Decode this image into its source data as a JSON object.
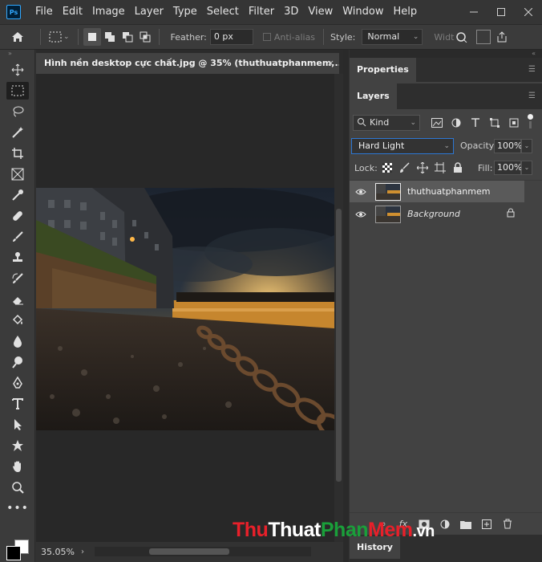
{
  "app": {
    "logo": "Ps"
  },
  "menu": [
    "File",
    "Edit",
    "Image",
    "Layer",
    "Type",
    "Select",
    "Filter",
    "3D",
    "View",
    "Window",
    "Help"
  ],
  "options_bar": {
    "feather_label": "Feather:",
    "feather_value": "0 px",
    "antialias_label": "Anti-alias",
    "style_label": "Style:",
    "style_value": "Normal",
    "width_label": "Widt"
  },
  "document": {
    "tab_title": "Hình nền desktop cực chất.jpg @ 35% (thuthuatphanmem,...",
    "tab_close": "×",
    "zoom": "35.05%"
  },
  "panels": {
    "properties_tab": "Properties",
    "layers_tab": "Layers",
    "history_tab": "History"
  },
  "layers_panel": {
    "kind_filter": "Kind",
    "blend_mode": "Hard Light",
    "opacity_label": "Opacity:",
    "opacity_value": "100%",
    "lock_label": "Lock:",
    "fill_label": "Fill:",
    "fill_value": "100%",
    "layers": [
      {
        "name": "thuthuatphanmem",
        "selected": true,
        "visible": true
      },
      {
        "name": "Background",
        "selected": false,
        "visible": true,
        "locked": true
      }
    ]
  },
  "watermark": {
    "part1": "Thu",
    "part2": "Thuat",
    "part3": "Phan",
    "part4": "Mem",
    "part5": ".vn"
  },
  "colors": {
    "accent": "#31a8ff",
    "panel_bg": "#424242",
    "app_bg": "#323232",
    "selected_row": "#5a5a5a",
    "blend_border": "#2d78d3"
  }
}
